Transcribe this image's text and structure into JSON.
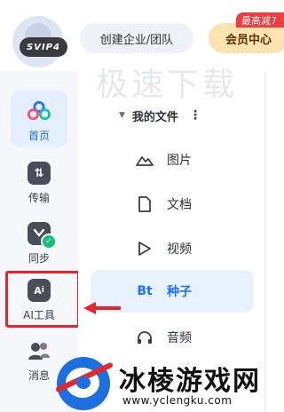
{
  "header": {
    "vip_label": "SVIP4",
    "enterprise_button": "创建企业/团队",
    "member_button": "会员中心",
    "promo_tag": "最高减7"
  },
  "watermark_top": "极速下载",
  "sidebar": {
    "items": [
      {
        "label": "首页",
        "icon": "cloud-icon"
      },
      {
        "label": "传输",
        "icon": "transfer-icon"
      },
      {
        "label": "同步",
        "icon": "sync-icon"
      },
      {
        "label": "AI工具",
        "icon": "ai-tools-icon"
      },
      {
        "label": "消息",
        "icon": "message-icon"
      }
    ]
  },
  "main": {
    "section_title": "我的文件",
    "nav": [
      {
        "label": "图片",
        "icon": "image-icon"
      },
      {
        "label": "文档",
        "icon": "document-icon"
      },
      {
        "label": "视频",
        "icon": "video-icon"
      },
      {
        "label": "种子",
        "icon_text": "Bt"
      },
      {
        "label": "音频",
        "icon": "audio-icon"
      }
    ]
  },
  "footer_watermark": {
    "title": "冰棱游戏网",
    "url": "www.yclengku.com"
  },
  "colors": {
    "accent": "#1a73ff",
    "highlight_red": "#e5262d",
    "sidebar_bg": "#f6f7fa",
    "selected_bg": "#e8f2fd"
  }
}
